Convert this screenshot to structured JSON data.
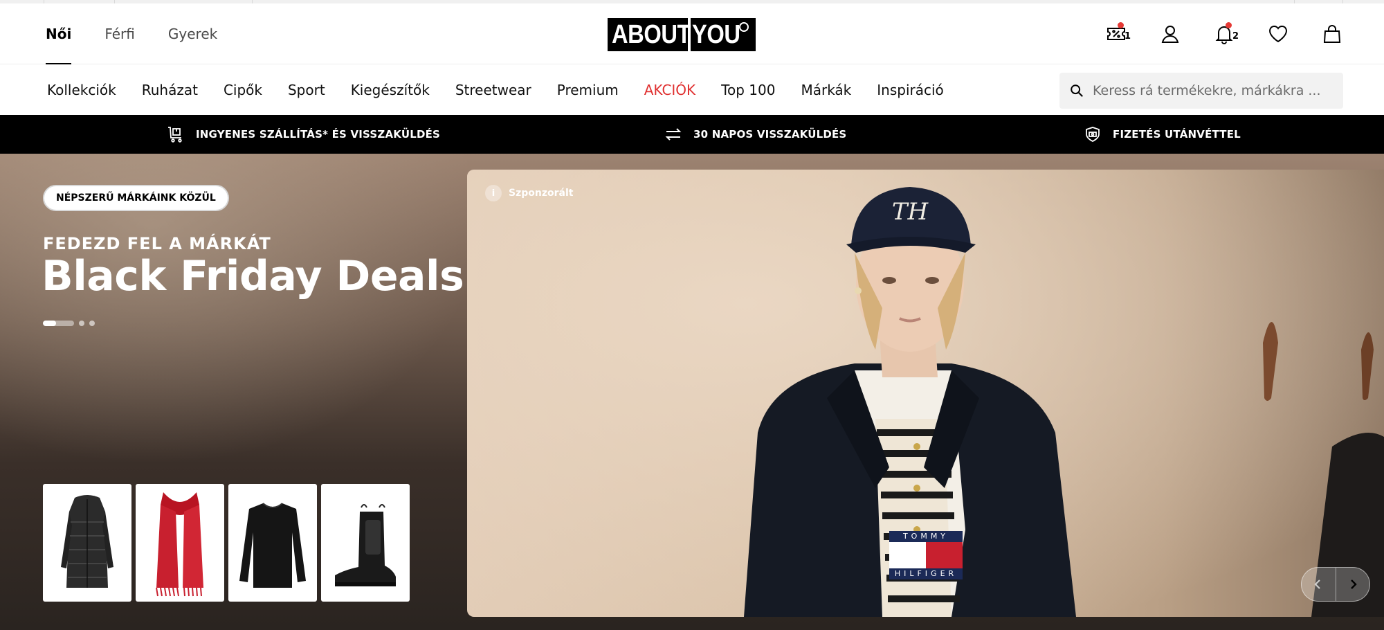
{
  "header": {
    "gender_tabs": [
      {
        "label": "Női",
        "active": true
      },
      {
        "label": "Férfi",
        "active": false
      },
      {
        "label": "Gyerek",
        "active": false
      }
    ],
    "logo": {
      "part1": "ABOUT",
      "part2": "YOU"
    },
    "icons": [
      {
        "name": "voucher-icon",
        "badge_count": "1",
        "has_dot": true
      },
      {
        "name": "account-icon"
      },
      {
        "name": "notification-bell-icon",
        "badge_count": "2",
        "has_dot": true
      },
      {
        "name": "wishlist-heart-icon"
      },
      {
        "name": "shopping-bag-icon"
      }
    ]
  },
  "category_nav": {
    "items": [
      "Kollekciók",
      "Ruházat",
      "Cipők",
      "Sport",
      "Kiegészítők",
      "Streetwear",
      "Premium",
      "AKCIÓK",
      "Top 100",
      "Márkák",
      "Inspiráció"
    ],
    "sale_item": "AKCIÓK",
    "sale_color": "#e03131",
    "search_placeholder": "Keress rá termékekre, márkákra ..."
  },
  "usp_bar": {
    "items": [
      {
        "icon": "delivery-cart-icon",
        "text": "INGYENES SZÁLLÍTÁS* ÉS VISSZAKÜLDÉS"
      },
      {
        "icon": "return-arrows-icon",
        "text": "30 NAPOS VISSZAKÜLDÉS"
      },
      {
        "icon": "cash-on-delivery-icon",
        "text": "FIZETÉS UTÁNVÉTTEL"
      }
    ]
  },
  "hero": {
    "pill": "NÉPSZERŰ MÁRKÁINK KÖZÜL",
    "eyebrow": "FEDEZD FEL A MÁRKÁT",
    "headline": "Black Friday Deals",
    "slide_count": 3,
    "active_slide": 1,
    "products": [
      {
        "name": "black-puffer-coat-thumbnail"
      },
      {
        "name": "red-scarf-thumbnail"
      },
      {
        "name": "black-sweater-thumbnail"
      },
      {
        "name": "black-chelsea-boot-thumbnail"
      }
    ],
    "campaign": {
      "sponsored_label": "Szponzorált",
      "brand_top": "TOMMY",
      "brand_bottom": "HILFIGER"
    }
  },
  "colors": {
    "accent_sale": "#e03131",
    "usp_bar_bg": "#000000",
    "badge_dot": "#e53935",
    "brand_navy": "#1b2a57",
    "brand_red": "#c8202f"
  }
}
